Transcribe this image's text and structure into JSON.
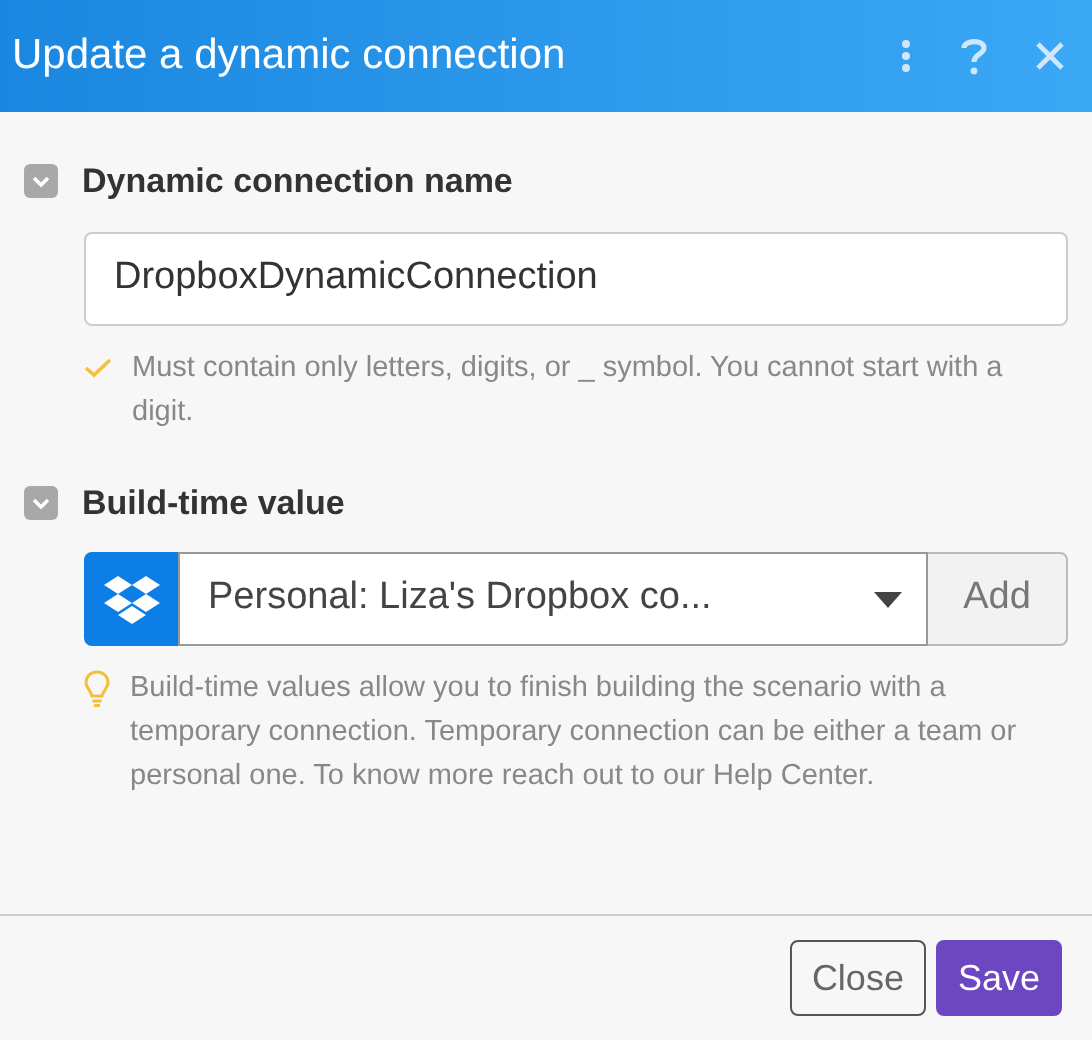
{
  "window": {
    "title": "Update a dynamic connection"
  },
  "sections": [
    {
      "kind": "text",
      "label": "Dynamic connection name",
      "expanded": true,
      "value": "DropboxDynamicConnection",
      "hint": {
        "kind": "check",
        "text": "Must contain only letters, digits, or _ symbol. You cannot start with a digit."
      }
    },
    {
      "kind": "select",
      "label": "Build-time value",
      "expanded": true,
      "value": "Personal: Liza's Dropbox co...",
      "add_label": "Add",
      "hint": {
        "kind": "bulb",
        "text": "Build-time values allow you to finish building the scenario with a temporary connection. Temporary connection can be either a team or personal one. To know more reach out to our Help Center."
      }
    }
  ],
  "buttons": {
    "close": "Close",
    "save": "Save"
  }
}
